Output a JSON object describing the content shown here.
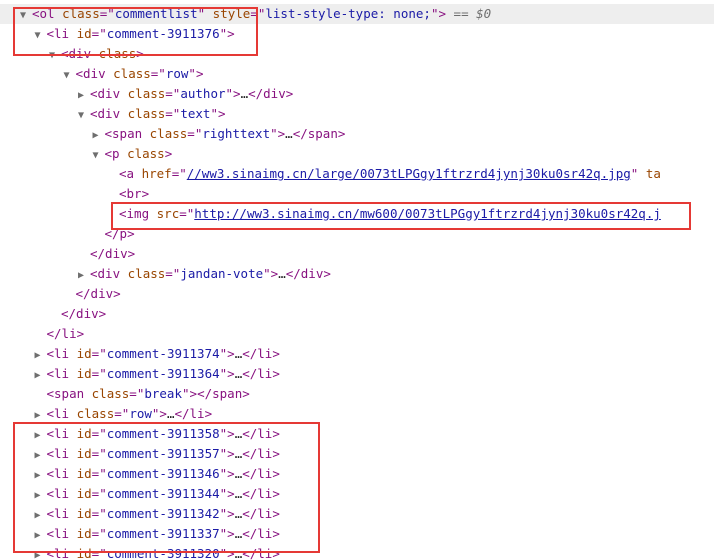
{
  "dom": {
    "lines": [
      {
        "depth": 0,
        "arrow": "▼",
        "parts": [
          [
            "tag",
            "<ol "
          ],
          [
            "an",
            "class"
          ],
          [
            "tag",
            "=\""
          ],
          [
            "av",
            "commentlist"
          ],
          [
            "tag",
            "\" "
          ],
          [
            "an",
            "style"
          ],
          [
            "tag",
            "=\""
          ],
          [
            "av",
            "list-style-type: none;"
          ],
          [
            "tag",
            "\">"
          ],
          [
            "muted",
            " == $0"
          ]
        ]
      },
      {
        "depth": 1,
        "arrow": "▼",
        "parts": [
          [
            "tag",
            "<li "
          ],
          [
            "an",
            "id"
          ],
          [
            "tag",
            "=\""
          ],
          [
            "av",
            "comment-3911376"
          ],
          [
            "tag",
            "\">"
          ]
        ]
      },
      {
        "depth": 2,
        "arrow": "▼",
        "parts": [
          [
            "tag",
            "<div "
          ],
          [
            "an",
            "class"
          ],
          [
            "tag",
            ">"
          ]
        ]
      },
      {
        "depth": 3,
        "arrow": "▼",
        "parts": [
          [
            "tag",
            "<div "
          ],
          [
            "an",
            "class"
          ],
          [
            "tag",
            "=\""
          ],
          [
            "av",
            "row"
          ],
          [
            "tag",
            "\">"
          ]
        ]
      },
      {
        "depth": 4,
        "arrow": "▶",
        "parts": [
          [
            "tag",
            "<div "
          ],
          [
            "an",
            "class"
          ],
          [
            "tag",
            "=\""
          ],
          [
            "av",
            "author"
          ],
          [
            "tag",
            "\">"
          ],
          [
            "txt",
            "…"
          ],
          [
            "tag",
            "</div>"
          ]
        ]
      },
      {
        "depth": 4,
        "arrow": "▼",
        "parts": [
          [
            "tag",
            "<div "
          ],
          [
            "an",
            "class"
          ],
          [
            "tag",
            "=\""
          ],
          [
            "av",
            "text"
          ],
          [
            "tag",
            "\">"
          ]
        ]
      },
      {
        "depth": 5,
        "arrow": "▶",
        "parts": [
          [
            "tag",
            "<span "
          ],
          [
            "an",
            "class"
          ],
          [
            "tag",
            "=\""
          ],
          [
            "av",
            "righttext"
          ],
          [
            "tag",
            "\">"
          ],
          [
            "txt",
            "…"
          ],
          [
            "tag",
            "</span>"
          ]
        ]
      },
      {
        "depth": 5,
        "arrow": "▼",
        "parts": [
          [
            "tag",
            "<p "
          ],
          [
            "an",
            "class"
          ],
          [
            "tag",
            ">"
          ]
        ]
      },
      {
        "depth": 6,
        "arrow": "",
        "parts": [
          [
            "tag",
            "<a "
          ],
          [
            "an",
            "href"
          ],
          [
            "tag",
            "=\""
          ],
          [
            "lnk",
            "//ww3.sinaimg.cn/large/0073tLPGgy1ftrzrd4jynj30ku0sr42q.jpg"
          ],
          [
            "tag",
            "\" "
          ],
          [
            "an",
            "ta"
          ]
        ]
      },
      {
        "depth": 6,
        "arrow": "",
        "parts": [
          [
            "tag",
            "<br>"
          ]
        ]
      },
      {
        "depth": 6,
        "arrow": "",
        "parts": [
          [
            "tag",
            "<img "
          ],
          [
            "an",
            "src"
          ],
          [
            "tag",
            "=\""
          ],
          [
            "lnk",
            "http://ww3.sinaimg.cn/mw600/0073tLPGgy1ftrzrd4jynj30ku0sr42q.j"
          ]
        ]
      },
      {
        "depth": 5,
        "arrow": "",
        "parts": [
          [
            "tag",
            "</p>"
          ]
        ]
      },
      {
        "depth": 4,
        "arrow": "",
        "parts": [
          [
            "tag",
            "</div>"
          ]
        ]
      },
      {
        "depth": 4,
        "arrow": "▶",
        "parts": [
          [
            "tag",
            "<div "
          ],
          [
            "an",
            "class"
          ],
          [
            "tag",
            "=\""
          ],
          [
            "av",
            "jandan-vote"
          ],
          [
            "tag",
            "\">"
          ],
          [
            "txt",
            "…"
          ],
          [
            "tag",
            "</div>"
          ]
        ]
      },
      {
        "depth": 3,
        "arrow": "",
        "parts": [
          [
            "tag",
            "</div>"
          ]
        ]
      },
      {
        "depth": 2,
        "arrow": "",
        "parts": [
          [
            "tag",
            "</div>"
          ]
        ]
      },
      {
        "depth": 1,
        "arrow": "",
        "parts": [
          [
            "tag",
            "</li>"
          ]
        ]
      },
      {
        "depth": 1,
        "arrow": "▶",
        "parts": [
          [
            "tag",
            "<li "
          ],
          [
            "an",
            "id"
          ],
          [
            "tag",
            "=\""
          ],
          [
            "av",
            "comment-3911374"
          ],
          [
            "tag",
            "\">"
          ],
          [
            "txt",
            "…"
          ],
          [
            "tag",
            "</li>"
          ]
        ]
      },
      {
        "depth": 1,
        "arrow": "▶",
        "parts": [
          [
            "tag",
            "<li "
          ],
          [
            "an",
            "id"
          ],
          [
            "tag",
            "=\""
          ],
          [
            "av",
            "comment-3911364"
          ],
          [
            "tag",
            "\">"
          ],
          [
            "txt",
            "…"
          ],
          [
            "tag",
            "</li>"
          ]
        ]
      },
      {
        "depth": 1,
        "arrow": "",
        "parts": [
          [
            "tag",
            "<span "
          ],
          [
            "an",
            "class"
          ],
          [
            "tag",
            "=\""
          ],
          [
            "av",
            "break"
          ],
          [
            "tag",
            "\">"
          ],
          [
            "tag",
            "</span>"
          ]
        ]
      },
      {
        "depth": 1,
        "arrow": "▶",
        "parts": [
          [
            "tag",
            "<li "
          ],
          [
            "an",
            "class"
          ],
          [
            "tag",
            "=\""
          ],
          [
            "av",
            "row"
          ],
          [
            "tag",
            "\">"
          ],
          [
            "txt",
            "…"
          ],
          [
            "tag",
            "</li>"
          ]
        ]
      },
      {
        "depth": 1,
        "arrow": "▶",
        "parts": [
          [
            "tag",
            "<li "
          ],
          [
            "an",
            "id"
          ],
          [
            "tag",
            "=\""
          ],
          [
            "av",
            "comment-3911358"
          ],
          [
            "tag",
            "\">"
          ],
          [
            "txt",
            "…"
          ],
          [
            "tag",
            "</li>"
          ]
        ]
      },
      {
        "depth": 1,
        "arrow": "▶",
        "parts": [
          [
            "tag",
            "<li "
          ],
          [
            "an",
            "id"
          ],
          [
            "tag",
            "=\""
          ],
          [
            "av",
            "comment-3911357"
          ],
          [
            "tag",
            "\">"
          ],
          [
            "txt",
            "…"
          ],
          [
            "tag",
            "</li>"
          ]
        ]
      },
      {
        "depth": 1,
        "arrow": "▶",
        "parts": [
          [
            "tag",
            "<li "
          ],
          [
            "an",
            "id"
          ],
          [
            "tag",
            "=\""
          ],
          [
            "av",
            "comment-3911346"
          ],
          [
            "tag",
            "\">"
          ],
          [
            "txt",
            "…"
          ],
          [
            "tag",
            "</li>"
          ]
        ]
      },
      {
        "depth": 1,
        "arrow": "▶",
        "parts": [
          [
            "tag",
            "<li "
          ],
          [
            "an",
            "id"
          ],
          [
            "tag",
            "=\""
          ],
          [
            "av",
            "comment-3911344"
          ],
          [
            "tag",
            "\">"
          ],
          [
            "txt",
            "…"
          ],
          [
            "tag",
            "</li>"
          ]
        ]
      },
      {
        "depth": 1,
        "arrow": "▶",
        "parts": [
          [
            "tag",
            "<li "
          ],
          [
            "an",
            "id"
          ],
          [
            "tag",
            "=\""
          ],
          [
            "av",
            "comment-3911342"
          ],
          [
            "tag",
            "\">"
          ],
          [
            "txt",
            "…"
          ],
          [
            "tag",
            "</li>"
          ]
        ]
      },
      {
        "depth": 1,
        "arrow": "▶",
        "parts": [
          [
            "tag",
            "<li "
          ],
          [
            "an",
            "id"
          ],
          [
            "tag",
            "=\""
          ],
          [
            "av",
            "comment-3911337"
          ],
          [
            "tag",
            "\">"
          ],
          [
            "txt",
            "…"
          ],
          [
            "tag",
            "</li>"
          ]
        ]
      },
      {
        "depth": 1,
        "arrow": "▶",
        "parts": [
          [
            "tag",
            "<li "
          ],
          [
            "an",
            "id"
          ],
          [
            "tag",
            "=\""
          ],
          [
            "av",
            "comment-3911320"
          ],
          [
            "tag",
            "\">"
          ],
          [
            "txt",
            "…"
          ],
          [
            "tag",
            "</li>"
          ]
        ]
      }
    ]
  },
  "colors": {
    "tag": "#881280",
    "attr_name": "#994500",
    "attr_value": "#1a1aa6",
    "highlight_box": "#e53935",
    "selected_row": "#eeeeee"
  }
}
